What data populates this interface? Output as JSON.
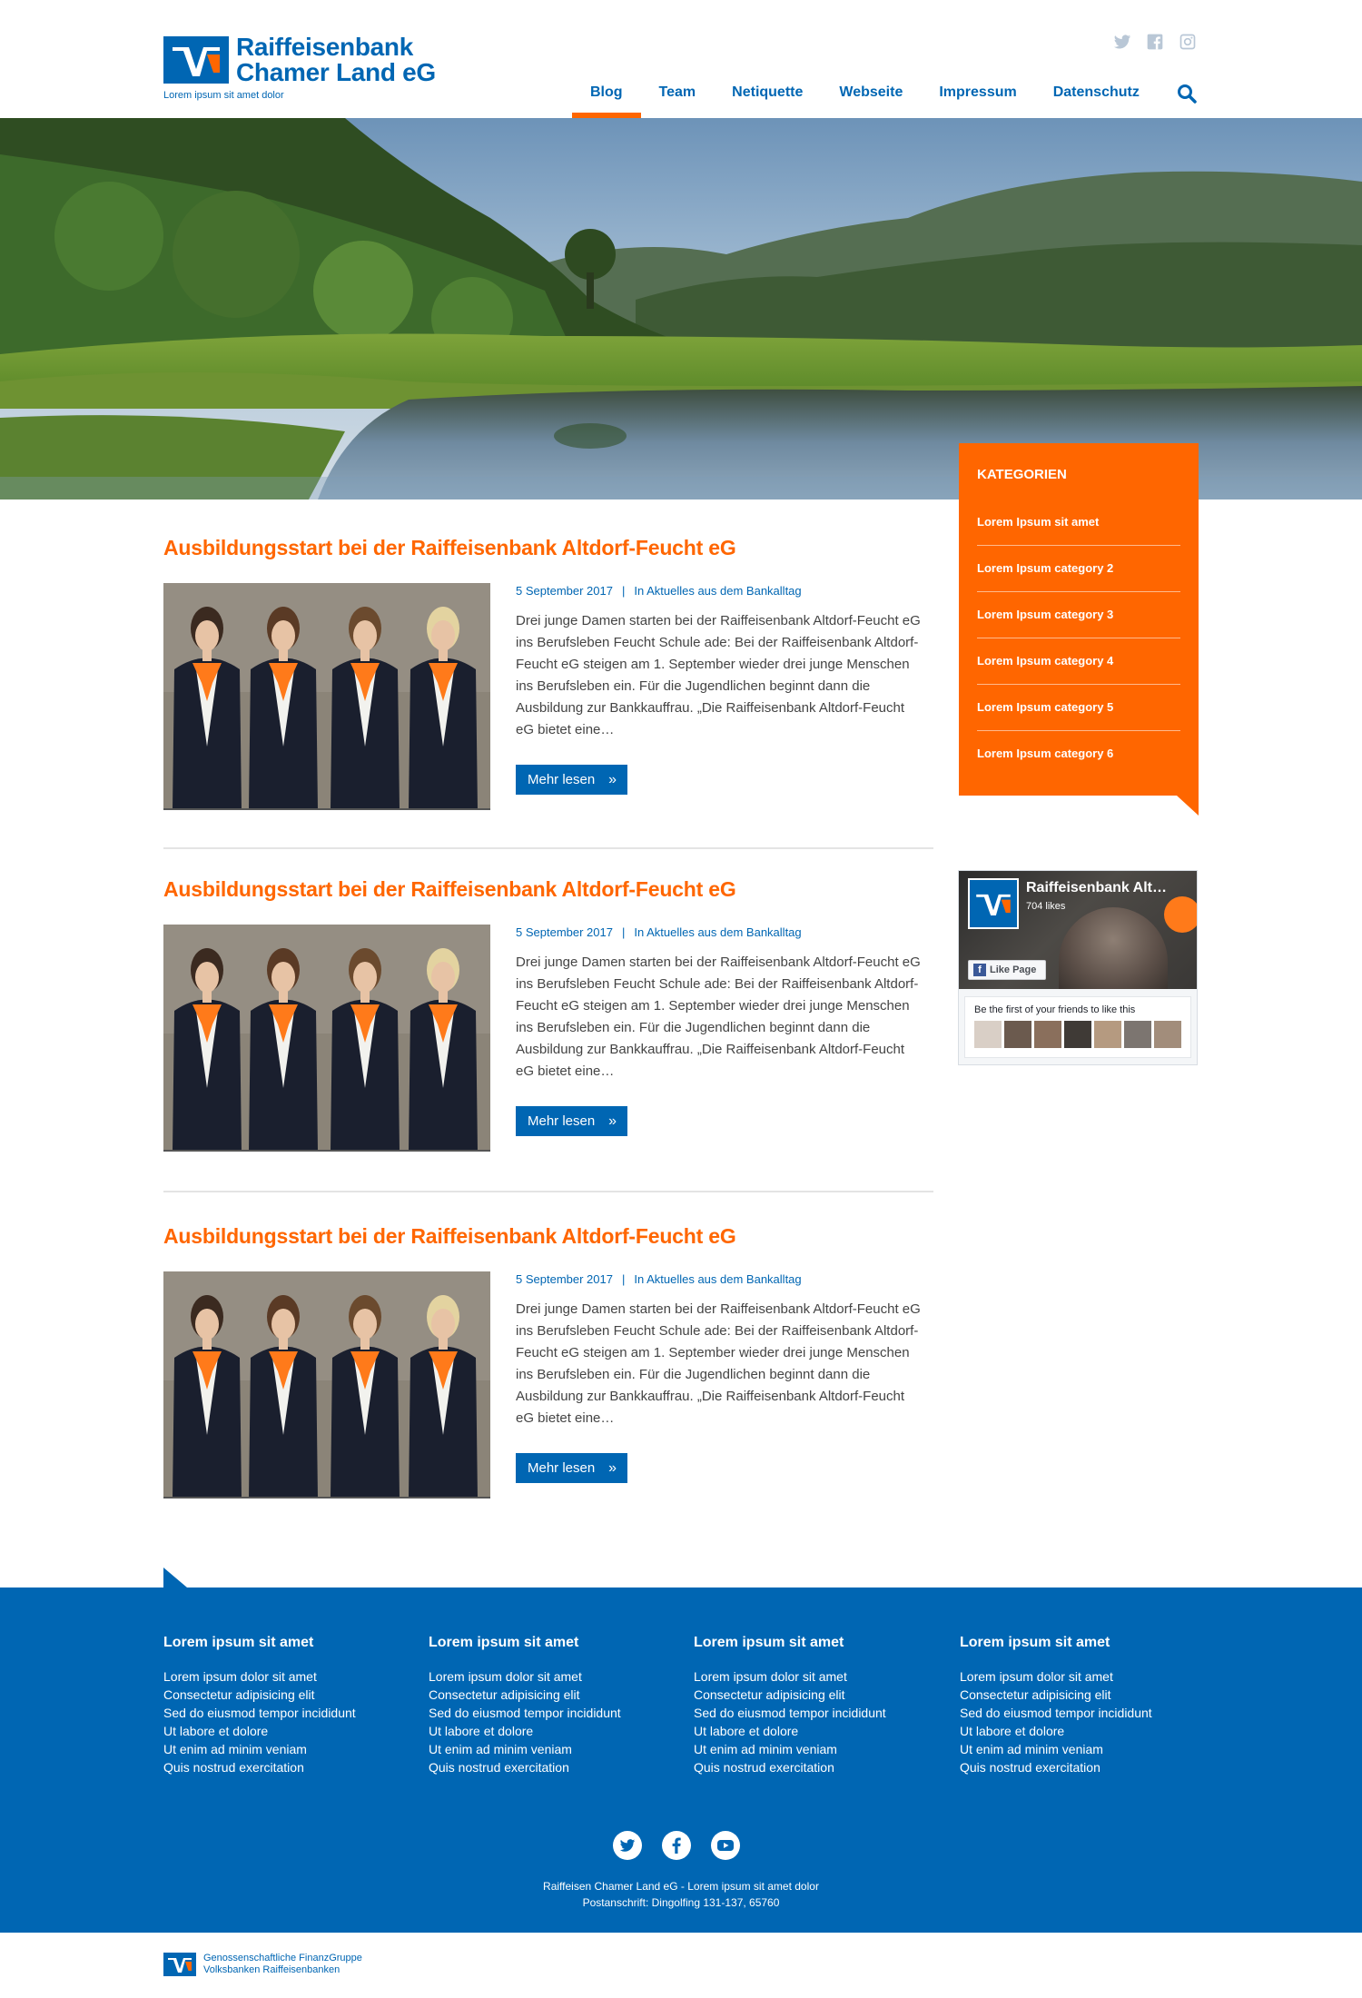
{
  "brand": {
    "name_line1": "Raiffeisenbank",
    "name_line2": "Chamer Land eG",
    "tagline": "Lorem ipsum sit amet dolor",
    "color_primary": "#0066b3",
    "color_accent": "#ff6600"
  },
  "social_top": [
    "twitter-icon",
    "facebook-icon",
    "instagram-icon"
  ],
  "nav": {
    "items": [
      {
        "label": "Blog",
        "active": true
      },
      {
        "label": "Team"
      },
      {
        "label": "Netiquette"
      },
      {
        "label": "Webseite"
      },
      {
        "label": "Impressum"
      },
      {
        "label": "Datenschutz"
      }
    ],
    "search_icon": "search-icon"
  },
  "categories": {
    "title": "KATEGORIEN",
    "items": [
      "Lorem Ipsum sit amet",
      "Lorem Ipsum category 2",
      "Lorem Ipsum category 3",
      "Lorem Ipsum category 4",
      "Lorem Ipsum category 5",
      "Lorem Ipsum category 6"
    ]
  },
  "facebook": {
    "page_name": "Raiffeisenbank Alt…",
    "likes": "704 likes",
    "like_button": "Like Page",
    "friends_text": "Be the first of your friends to like this"
  },
  "posts": [
    {
      "title": "Ausbildungsstart bei der Raiffeisenbank Altdorf-Feucht eG",
      "date": "5 September 2017",
      "separator": "|",
      "category": "In Aktuelles aus dem Bankalltag",
      "excerpt": "Drei junge Damen starten bei der Raiffeisenbank Altdorf-Feucht eG ins Berufsleben Feucht Schule ade: Bei der Raiffeisenbank Altdorf-Feucht eG steigen am 1. September wieder drei junge Menschen ins Berufsleben ein. Für die Jugendlichen beginnt dann die Ausbildung zur Bankkauffrau. „Die Raiffeisenbank Altdorf-Feucht eG bietet eine…",
      "button": "Mehr lesen"
    },
    {
      "title": "Ausbildungsstart bei der Raiffeisenbank Altdorf-Feucht eG",
      "date": "5 September 2017",
      "separator": "|",
      "category": "In Aktuelles aus dem Bankalltag",
      "excerpt": "Drei junge Damen starten bei der Raiffeisenbank Altdorf-Feucht eG ins Berufsleben Feucht Schule ade: Bei der Raiffeisenbank Altdorf-Feucht eG steigen am 1. September wieder drei junge Menschen ins Berufsleben ein. Für die Jugendlichen beginnt dann die Ausbildung zur Bankkauffrau. „Die Raiffeisenbank Altdorf-Feucht eG bietet eine…",
      "button": "Mehr lesen"
    },
    {
      "title": "Ausbildungsstart bei der Raiffeisenbank Altdorf-Feucht eG",
      "date": "5 September 2017",
      "separator": "|",
      "category": "In Aktuelles aus dem Bankalltag",
      "excerpt": "Drei junge Damen starten bei der Raiffeisenbank Altdorf-Feucht eG ins Berufsleben Feucht Schule ade: Bei der Raiffeisenbank Altdorf-Feucht eG steigen am 1. September wieder drei junge Menschen ins Berufsleben ein. Für die Jugendlichen beginnt dann die Ausbildung zur Bankkauffrau. „Die Raiffeisenbank Altdorf-Feucht eG bietet eine…",
      "button": "Mehr lesen"
    }
  ],
  "footer": {
    "columns": [
      {
        "title": "Lorem ipsum sit amet",
        "items": [
          "Lorem ipsum dolor sit amet",
          "Consectetur adipisicing elit",
          "Sed do eiusmod tempor incididunt",
          "Ut labore et dolore",
          "Ut enim ad minim veniam",
          "Quis nostrud exercitation"
        ]
      },
      {
        "title": "Lorem ipsum sit amet",
        "items": [
          "Lorem ipsum dolor sit amet",
          "Consectetur adipisicing elit",
          "Sed do eiusmod tempor incididunt",
          "Ut labore et dolore",
          "Ut enim ad minim veniam",
          "Quis nostrud exercitation"
        ]
      },
      {
        "title": "Lorem ipsum sit amet",
        "items": [
          "Lorem ipsum dolor sit amet",
          "Consectetur adipisicing elit",
          "Sed do eiusmod tempor incididunt",
          "Ut labore et dolore",
          "Ut enim ad minim veniam",
          "Quis nostrud exercitation"
        ]
      },
      {
        "title": "Lorem ipsum sit amet",
        "items": [
          "Lorem ipsum dolor sit amet",
          "Consectetur adipisicing elit",
          "Sed do eiusmod tempor incididunt",
          "Ut labore et dolore",
          "Ut enim ad minim veniam",
          "Quis nostrud exercitation"
        ]
      }
    ],
    "social": [
      "twitter-icon",
      "facebook-icon",
      "youtube-icon"
    ],
    "address_line1": "Raiffeisen Chamer Land eG - Lorem ipsum sit amet dolor",
    "address_line2": "Postanschrift: Dingolfing 131-137, 65760"
  },
  "bottom_brand": {
    "line1": "Genossenschaftliche FinanzGruppe",
    "line2": "Volksbanken Raiffeisenbanken"
  }
}
